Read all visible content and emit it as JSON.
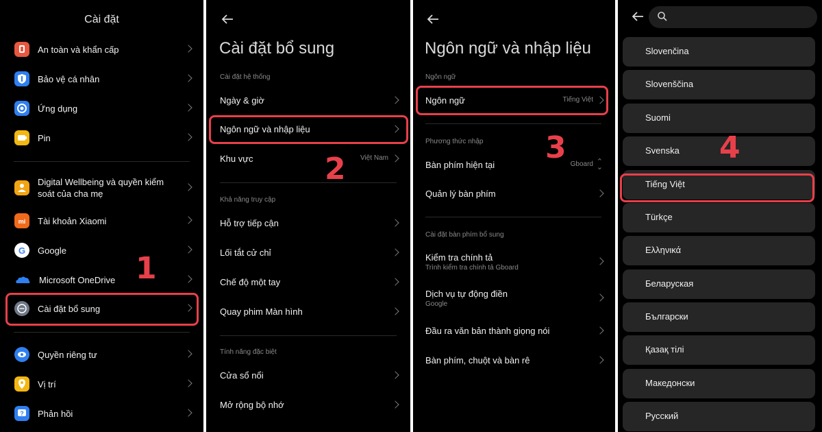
{
  "panel1": {
    "title": "Cài đặt",
    "items": [
      {
        "label": "An toàn và khẩn cấp",
        "icon": "shield-alert-icon",
        "color": "#e8573f"
      },
      {
        "label": "Bảo vệ cá nhân",
        "icon": "privacy-protection-icon",
        "color": "#2f7ff0"
      },
      {
        "label": "Ứng dụng",
        "icon": "apps-icon",
        "color": "#2f7ff0"
      },
      {
        "label": "Pin",
        "icon": "battery-icon",
        "color": "#f2b712"
      },
      {
        "label": "Digital Wellbeing và quyền kiểm soát của cha mẹ",
        "icon": "wellbeing-icon",
        "color": "#f2a412"
      },
      {
        "label": "Tài khoản Xiaomi",
        "icon": "xiaomi-icon",
        "color": "#f06a1c"
      },
      {
        "label": "Google",
        "icon": "google-icon",
        "color": "#ffffff"
      },
      {
        "label": "Microsoft OneDrive",
        "icon": "onedrive-icon",
        "color": "#2f7ff0"
      },
      {
        "label": "Cài đặt bổ sung",
        "icon": "more-settings-icon",
        "color": "#6f7888"
      },
      {
        "label": "Quyền riêng tư",
        "icon": "eye-icon",
        "color": "#2f7ff0"
      },
      {
        "label": "Vị trí",
        "icon": "location-icon",
        "color": "#f2b712"
      },
      {
        "label": "Phản hồi",
        "icon": "feedback-icon",
        "color": "#2f7ff0"
      }
    ],
    "step": "1"
  },
  "panel2": {
    "title": "Cài đặt bổ sung",
    "sec_system": "Cài đặt hệ thống",
    "date_time": "Ngày & giờ",
    "language_input": "Ngôn ngữ và nhập liệu",
    "region": "Khu vực",
    "region_value": "Việt Nam",
    "sec_access": "Khả năng truy cập",
    "accessibility": "Hỗ trợ tiếp cận",
    "gesture_shortcuts": "Lối tắt cử chỉ",
    "one_hand": "Chế độ một tay",
    "screen_record": "Quay phim Màn hình",
    "sec_special": "Tính năng đặc biệt",
    "floating_window": "Cửa sổ nổi",
    "memory_ext": "Mở rộng bộ nhớ",
    "step": "2"
  },
  "panel3": {
    "title": "Ngôn ngữ và nhập liệu",
    "sec_language": "Ngôn ngữ",
    "language": "Ngôn ngữ",
    "language_value": "Tiếng Việt",
    "sec_input": "Phương thức nhập",
    "current_keyboard": "Bàn phím hiện tại",
    "current_keyboard_value": "Gboard",
    "manage_keyboard": "Quản lý bàn phím",
    "sec_extra": "Cài đặt bàn phím bổ sung",
    "spell_check": "Kiểm tra chính tả",
    "spell_check_sub": "Trình kiểm tra chính tả Gboard",
    "autofill": "Dịch vụ tự động điền",
    "autofill_sub": "Google",
    "tts": "Đầu ra văn bản thành giọng nói",
    "mouse": "Bàn phím, chuột và bàn rê",
    "step": "3"
  },
  "panel4": {
    "languages": [
      "Slovenčina",
      "Slovenščina",
      "Suomi",
      "Svenska",
      "Tiếng Việt",
      "Türkçe",
      "Ελληνικά",
      "Беларуская",
      "Български",
      "Қазақ тілі",
      "Македонски",
      "Русский"
    ],
    "step": "4"
  },
  "accent": "#e8404a"
}
